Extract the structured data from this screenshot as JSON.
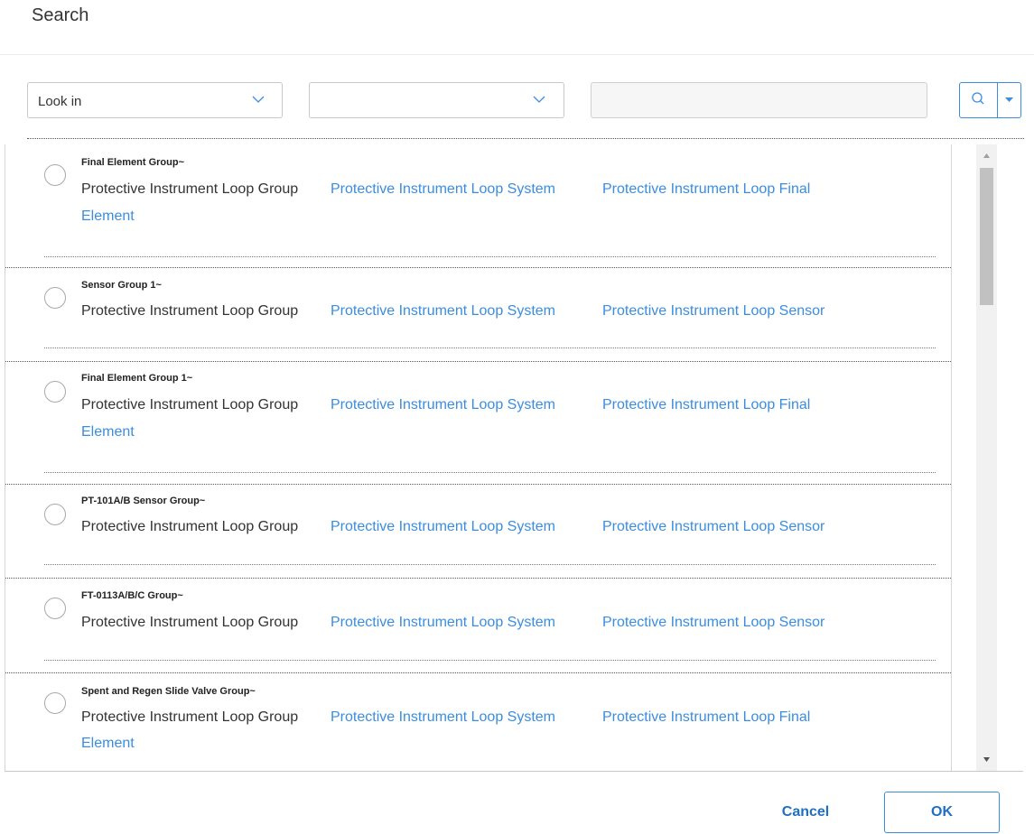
{
  "dialog": {
    "title": "Search"
  },
  "toolbar": {
    "look_in": {
      "selected": "Look in"
    },
    "second_select": {
      "selected": ""
    },
    "query": {
      "value": "",
      "placeholder": ""
    },
    "search_icon": "search-icon",
    "dropdown_icon": "caret-down-icon"
  },
  "results": [
    {
      "title": "Final Element Group~",
      "group": "Protective Instrument Loop Group",
      "system": "Protective Instrument Loop System",
      "type_line1": "Protective Instrument Loop Final",
      "type_line2": "Element"
    },
    {
      "title": "Sensor Group 1~",
      "group": "Protective Instrument Loop Group",
      "system": "Protective Instrument Loop System",
      "type_line1": "Protective Instrument Loop Sensor",
      "type_line2": ""
    },
    {
      "title": "Final Element Group 1~",
      "group": "Protective Instrument Loop Group",
      "system": "Protective Instrument Loop System",
      "type_line1": "Protective Instrument Loop Final",
      "type_line2": "Element"
    },
    {
      "title": "PT-101A/B Sensor Group~",
      "group": "Protective Instrument Loop Group",
      "system": "Protective Instrument Loop System",
      "type_line1": "Protective Instrument Loop Sensor",
      "type_line2": ""
    },
    {
      "title": "FT-0113A/B/C Group~",
      "group": "Protective Instrument Loop Group",
      "system": "Protective Instrument Loop System",
      "type_line1": "Protective Instrument Loop Sensor",
      "type_line2": ""
    },
    {
      "title": "Spent and Regen Slide Valve Group~",
      "group": "Protective Instrument Loop Group",
      "system": "Protective Instrument Loop System",
      "type_line1": "Protective Instrument Loop Final",
      "type_line2": "Element"
    }
  ],
  "footer": {
    "cancel_label": "Cancel",
    "ok_label": "OK"
  },
  "colors": {
    "accent": "#3a8de0",
    "link": "#3a8de0",
    "text": "#333333"
  }
}
